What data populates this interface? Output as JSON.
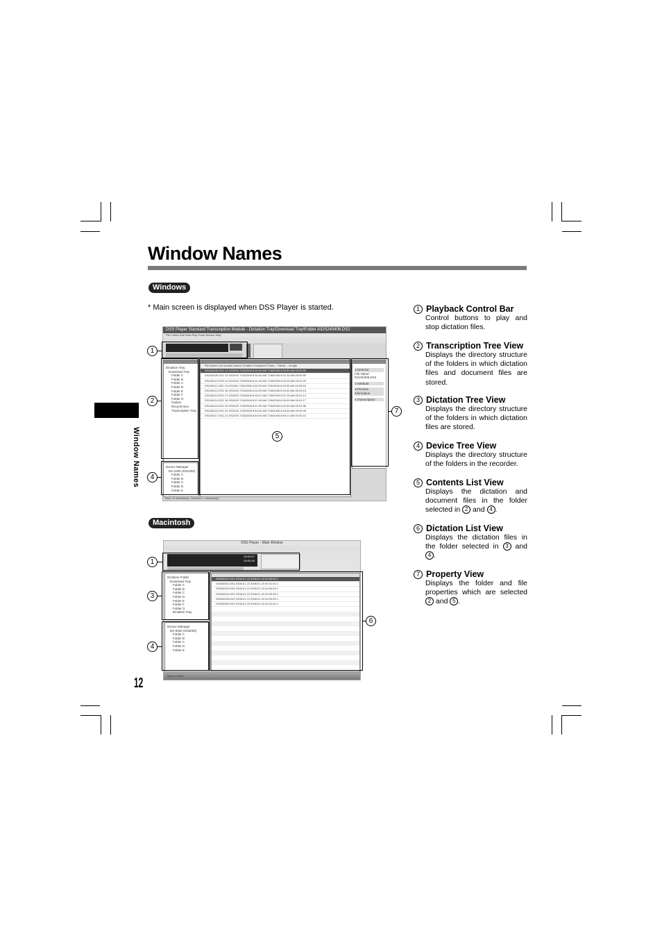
{
  "page": {
    "title": "Window Names",
    "side_label": "Window Names",
    "page_number": "12"
  },
  "sections": {
    "windows_label": "Windows",
    "macintosh_label": "Macintosh",
    "note": "* Main screen is displayed when DSS Player is started."
  },
  "descriptions": [
    {
      "num": "1",
      "title": "Playback Control Bar",
      "body": "Control buttons to play and stop dictation files."
    },
    {
      "num": "2",
      "title": "Transcription Tree View",
      "body": "Displays the directory structure of the folders in which dictation files and document files are stored."
    },
    {
      "num": "3",
      "title": "Dictation Tree View",
      "body": "Displays the directory structure of the folders in which dictation files are stored."
    },
    {
      "num": "4",
      "title": "Device Tree View",
      "body": "Displays the directory structure of the folders in the recorder."
    },
    {
      "num": "5",
      "title": "Contents List View",
      "body_pre": "Displays the dictation and document files in the folder selected in",
      "ref_a": "2",
      "mid": "and",
      "ref_b": "4",
      "post": "."
    },
    {
      "num": "6",
      "title": "Dictation List View",
      "body_pre": "Displays the dictation files in the folder selected in",
      "ref_a": "3",
      "mid": "and",
      "ref_b": "4",
      "post": "."
    },
    {
      "num": "7",
      "title": "Property View",
      "body_pre": "Displays the folder and file properties which are selected",
      "ref_a": "2",
      "mid": "and",
      "ref_b": "5",
      "post": "."
    }
  ],
  "windows_shot": {
    "window_title": "DSS Player Standard Transcription Module - Dictation Tray\\Download Tray\\Folder A\\DS240408.DS2",
    "menu": "File  Folder  Edit  View  Play  Tools  Service  Help",
    "columns": [
      "File Name",
      "Job number",
      "Author",
      "Created",
      "Completed",
      "Trans...",
      "Transc...",
      "Length"
    ],
    "rows": [
      [
        "DS240408.DS2",
        "12",
        "DS2400",
        "7/26/2008 8:26:00 AM",
        "7/26/2008 8:26:30 AM",
        "",
        "",
        "00:00:30"
      ],
      [
        "DS240409.DS2",
        "13",
        "DS2400",
        "7/26/2008 8:30:45 AM",
        "7/26/2008 8:31:34 AM",
        "",
        "",
        "00:00:50"
      ],
      [
        "DS240410.DS2",
        "14",
        "DS2400",
        "7/26/2008 8:31:45 AM",
        "7/26/2008 8:32:00 AM",
        "",
        "",
        "00:01:20"
      ],
      [
        "DS240411.DS2",
        "15",
        "DS2400",
        "7/26/2008 8:32:00 AM",
        "7/26/2008 8:33:00 AM",
        "",
        "",
        "00:00:50"
      ],
      [
        "DS240412.DS2",
        "16",
        "DS2400",
        "7/26/2008 8:34:00 AM",
        "7/26/2008 8:34:30 AM",
        "",
        "",
        "00:02:15"
      ],
      [
        "DS240413.DS2",
        "17",
        "DS2400",
        "7/26/2008 8:35:27 AM",
        "7/26/2008 8:37:15 AM",
        "",
        "",
        "00:01:12"
      ],
      [
        "DS240414.DS2",
        "18",
        "DS2400",
        "7/26/2008 8:37:45 AM",
        "7/26/2008 8:39:00 AM",
        "",
        "",
        "00:01:17"
      ],
      [
        "DS240415.DS2",
        "19",
        "DS2400",
        "7/26/2008 8:41:30 AM",
        "7/26/2008 8:42:50 AM",
        "",
        "",
        "00:01:36"
      ],
      [
        "DS240416.DS2",
        "20",
        "DS2400",
        "7/26/2008 8:43:00 AM",
        "7/26/2008 8:44:00 AM",
        "",
        "",
        "00:00:40"
      ],
      [
        "DS240417.DS2",
        "21",
        "DS2400",
        "7/26/2008 8:54:00 AM",
        "7/26/2008 8:56:11 AM",
        "",
        "",
        "00:02:15"
      ]
    ],
    "tree": [
      "Dictation Tray",
      "Download Tray",
      "Folder A",
      "Folder B",
      "Folder C",
      "Folder D",
      "Folder E",
      "Folder F",
      "Folder G",
      "Outbox",
      "Recycle Box",
      "Transcription Tray"
    ],
    "device_tree": [
      "Device Manager",
      "DS-2400 (DS2400)",
      "Folder A",
      "Folder B",
      "Folder C",
      "Folder D",
      "Folder E"
    ],
    "property_sections": [
      "1.General",
      "2.Attribute",
      "3.Process information",
      "4.Transcription"
    ],
    "property_file_name_label": "File Name:",
    "property_file_name": "DS240408.DS2",
    "status": "Total: 10 dictation(s), Selected: 1 dictation(s)"
  },
  "mac_shot": {
    "window_title": "DSS Player - Main Window",
    "time_a": "00:00:07",
    "time_b": "00:00:40",
    "tree": [
      "Dictation Folder",
      "Download Tray",
      "Folder A",
      "Folder B",
      "Folder C",
      "Folder D",
      "Folder E",
      "Folder F",
      "Folder G",
      "Dictation Tray"
    ],
    "device_tree": [
      "Device Manager",
      "DS-5000 (DS5000)",
      "Folder A",
      "Folder B",
      "Folder C",
      "Folder D",
      "Folder E"
    ],
    "rows": [
      [
        "DS500001.DS2",
        "2008.01.23",
        "2008.01.23",
        "00:00:40",
        "1"
      ],
      [
        "DS500002.DS2",
        "2008.01.23",
        "2008.01.23",
        "00:01:00",
        "1"
      ],
      [
        "DS500003.DS2",
        "2008.01.23",
        "2008.01.23",
        "00:00:05",
        "1"
      ],
      [
        "DS500004.DS2",
        "2008.01.23",
        "2008.01.23",
        "00:00:05",
        "1"
      ],
      [
        "DS500005.DS2",
        "2008.01.23",
        "2008.01.23",
        "00:00:05",
        "1"
      ],
      [
        "DS500006.DS2",
        "2008.01.23",
        "2008.01.23",
        "00:01:00",
        "1"
      ]
    ],
    "status": "Total of 6 files"
  },
  "callouts": {
    "one": "1",
    "two": "2",
    "three": "3",
    "four": "4",
    "five": "5",
    "six": "6",
    "seven": "7"
  }
}
